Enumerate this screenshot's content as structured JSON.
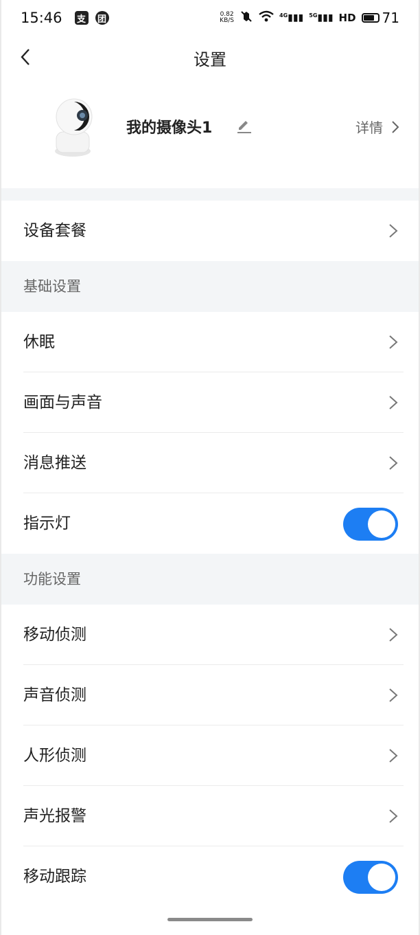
{
  "status_bar": {
    "time": "15:46",
    "app1_glyph": "支",
    "app2_glyph": "团",
    "net_speed_value": "0.82",
    "net_speed_unit": "KB/S",
    "sig1": "4G",
    "sig2": "5G",
    "hd": "HD",
    "battery_level": "71",
    "battery_fraction": 0.71
  },
  "nav": {
    "title": "设置"
  },
  "device": {
    "name": "我的摄像头1",
    "detail_label": "详情"
  },
  "rows_top": [
    {
      "label": "设备套餐"
    }
  ],
  "sections": [
    {
      "title": "基础设置",
      "items": [
        {
          "label": "休眠",
          "control": "chevron"
        },
        {
          "label": "画面与声音",
          "control": "chevron"
        },
        {
          "label": "消息推送",
          "control": "chevron"
        },
        {
          "label": "指示灯",
          "control": "toggle",
          "on": true
        }
      ]
    },
    {
      "title": "功能设置",
      "items": [
        {
          "label": "移动侦测",
          "control": "chevron"
        },
        {
          "label": "声音侦测",
          "control": "chevron"
        },
        {
          "label": "人形侦测",
          "control": "chevron"
        },
        {
          "label": "声光报警",
          "control": "chevron"
        },
        {
          "label": "移动跟踪",
          "control": "toggle",
          "on": true
        }
      ]
    }
  ],
  "colors": {
    "accent": "#1d7ef3",
    "section_bg": "#f3f5f7"
  }
}
